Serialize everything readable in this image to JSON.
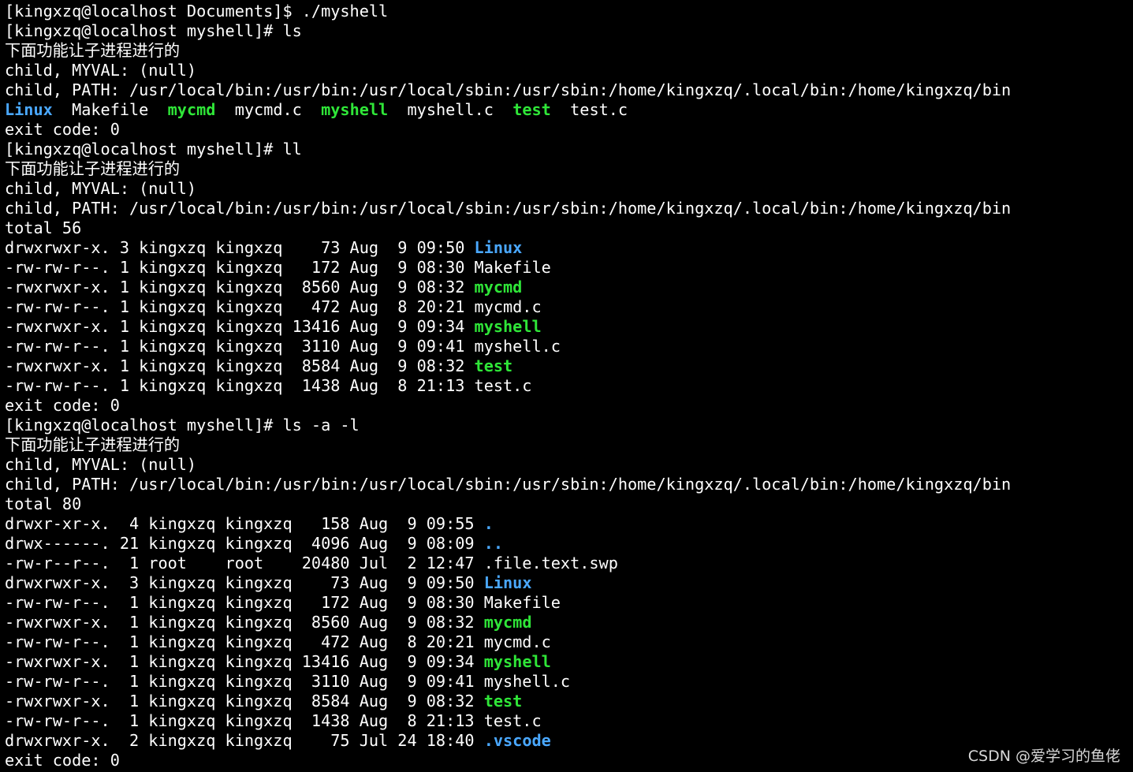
{
  "terminal": {
    "background": "#000000",
    "colors": {
      "white": "#ffffff",
      "blue": "#4aa8ff",
      "green": "#2fe638"
    },
    "lines": [
      [
        {
          "t": "[kingxzq@localhost Documents]$ ./myshell",
          "c": "white"
        }
      ],
      [
        {
          "t": "[kingxzq@localhost myshell]# ls",
          "c": "white"
        }
      ],
      [
        {
          "t": "下面功能让子进程进行的",
          "c": "white"
        }
      ],
      [
        {
          "t": "child, MYVAL: (null)",
          "c": "white"
        }
      ],
      [
        {
          "t": "child, PATH: /usr/local/bin:/usr/bin:/usr/local/sbin:/usr/sbin:/home/kingxzq/.local/bin:/home/kingxzq/bin",
          "c": "white"
        }
      ],
      [
        {
          "t": "Linux",
          "c": "blue"
        },
        {
          "t": "  Makefile  ",
          "c": "white"
        },
        {
          "t": "mycmd",
          "c": "green"
        },
        {
          "t": "  mycmd.c  ",
          "c": "white"
        },
        {
          "t": "myshell",
          "c": "green"
        },
        {
          "t": "  myshell.c  ",
          "c": "white"
        },
        {
          "t": "test",
          "c": "green"
        },
        {
          "t": "  test.c",
          "c": "white"
        }
      ],
      [
        {
          "t": "exit code: 0",
          "c": "white"
        }
      ],
      [
        {
          "t": "[kingxzq@localhost myshell]# ll",
          "c": "white"
        }
      ],
      [
        {
          "t": "下面功能让子进程进行的",
          "c": "white"
        }
      ],
      [
        {
          "t": "child, MYVAL: (null)",
          "c": "white"
        }
      ],
      [
        {
          "t": "child, PATH: /usr/local/bin:/usr/bin:/usr/local/sbin:/usr/sbin:/home/kingxzq/.local/bin:/home/kingxzq/bin",
          "c": "white"
        }
      ],
      [
        {
          "t": "total 56",
          "c": "white"
        }
      ],
      [
        {
          "t": "drwxrwxr-x. 3 kingxzq kingxzq    73 Aug  9 09:50 ",
          "c": "white"
        },
        {
          "t": "Linux",
          "c": "blue"
        }
      ],
      [
        {
          "t": "-rw-rw-r--. 1 kingxzq kingxzq   172 Aug  9 08:30 Makefile",
          "c": "white"
        }
      ],
      [
        {
          "t": "-rwxrwxr-x. 1 kingxzq kingxzq  8560 Aug  9 08:32 ",
          "c": "white"
        },
        {
          "t": "mycmd",
          "c": "green"
        }
      ],
      [
        {
          "t": "-rw-rw-r--. 1 kingxzq kingxzq   472 Aug  8 20:21 mycmd.c",
          "c": "white"
        }
      ],
      [
        {
          "t": "-rwxrwxr-x. 1 kingxzq kingxzq 13416 Aug  9 09:34 ",
          "c": "white"
        },
        {
          "t": "myshell",
          "c": "green"
        }
      ],
      [
        {
          "t": "-rw-rw-r--. 1 kingxzq kingxzq  3110 Aug  9 09:41 myshell.c",
          "c": "white"
        }
      ],
      [
        {
          "t": "-rwxrwxr-x. 1 kingxzq kingxzq  8584 Aug  9 08:32 ",
          "c": "white"
        },
        {
          "t": "test",
          "c": "green"
        }
      ],
      [
        {
          "t": "-rw-rw-r--. 1 kingxzq kingxzq  1438 Aug  8 21:13 test.c",
          "c": "white"
        }
      ],
      [
        {
          "t": "exit code: 0",
          "c": "white"
        }
      ],
      [
        {
          "t": "[kingxzq@localhost myshell]# ls -a -l",
          "c": "white"
        }
      ],
      [
        {
          "t": "下面功能让子进程进行的",
          "c": "white"
        }
      ],
      [
        {
          "t": "child, MYVAL: (null)",
          "c": "white"
        }
      ],
      [
        {
          "t": "child, PATH: /usr/local/bin:/usr/bin:/usr/local/sbin:/usr/sbin:/home/kingxzq/.local/bin:/home/kingxzq/bin",
          "c": "white"
        }
      ],
      [
        {
          "t": "total 80",
          "c": "white"
        }
      ],
      [
        {
          "t": "drwxr-xr-x.  4 kingxzq kingxzq   158 Aug  9 09:55 ",
          "c": "white"
        },
        {
          "t": ".",
          "c": "blue"
        }
      ],
      [
        {
          "t": "drwx------. 21 kingxzq kingxzq  4096 Aug  9 08:09 ",
          "c": "white"
        },
        {
          "t": "..",
          "c": "blue"
        }
      ],
      [
        {
          "t": "-rw-r--r--.  1 root    root    20480 Jul  2 12:47 .file.text.swp",
          "c": "white"
        }
      ],
      [
        {
          "t": "drwxrwxr-x.  3 kingxzq kingxzq    73 Aug  9 09:50 ",
          "c": "white"
        },
        {
          "t": "Linux",
          "c": "blue"
        }
      ],
      [
        {
          "t": "-rw-rw-r--.  1 kingxzq kingxzq   172 Aug  9 08:30 Makefile",
          "c": "white"
        }
      ],
      [
        {
          "t": "-rwxrwxr-x.  1 kingxzq kingxzq  8560 Aug  9 08:32 ",
          "c": "white"
        },
        {
          "t": "mycmd",
          "c": "green"
        }
      ],
      [
        {
          "t": "-rw-rw-r--.  1 kingxzq kingxzq   472 Aug  8 20:21 mycmd.c",
          "c": "white"
        }
      ],
      [
        {
          "t": "-rwxrwxr-x.  1 kingxzq kingxzq 13416 Aug  9 09:34 ",
          "c": "white"
        },
        {
          "t": "myshell",
          "c": "green"
        }
      ],
      [
        {
          "t": "-rw-rw-r--.  1 kingxzq kingxzq  3110 Aug  9 09:41 myshell.c",
          "c": "white"
        }
      ],
      [
        {
          "t": "-rwxrwxr-x.  1 kingxzq kingxzq  8584 Aug  9 08:32 ",
          "c": "white"
        },
        {
          "t": "test",
          "c": "green"
        }
      ],
      [
        {
          "t": "-rw-rw-r--.  1 kingxzq kingxzq  1438 Aug  8 21:13 test.c",
          "c": "white"
        }
      ],
      [
        {
          "t": "drwxrwxr-x.  2 kingxzq kingxzq    75 Jul 24 18:40 ",
          "c": "white"
        },
        {
          "t": ".vscode",
          "c": "blue"
        }
      ],
      [
        {
          "t": "exit code: 0",
          "c": "white"
        }
      ]
    ]
  },
  "watermark": "CSDN @爱学习的鱼佬"
}
